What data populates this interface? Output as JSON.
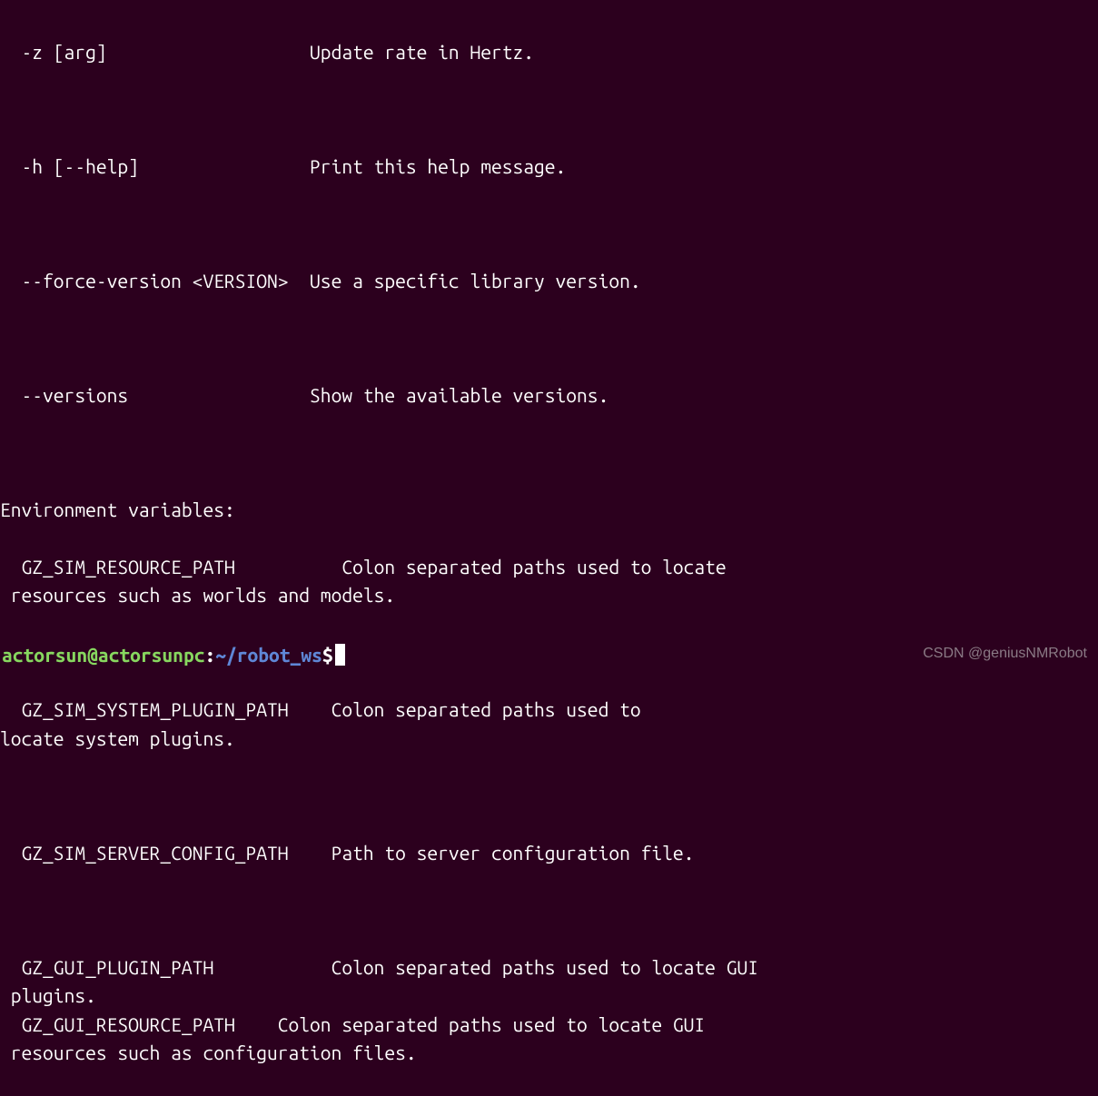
{
  "options": [
    {
      "flag": "  -z [arg]                   ",
      "desc": "Update rate in Hertz."
    },
    {
      "flag": "  -h [--help]                ",
      "desc": "Print this help message."
    },
    {
      "flag": "  --force-version <VERSION>  ",
      "desc": "Use a specific library version."
    },
    {
      "flag": "  --versions                 ",
      "desc": "Show the available versions."
    }
  ],
  "env_section_header": "Environment variables:",
  "env_vars": [
    {
      "text": "  GZ_SIM_RESOURCE_PATH          Colon separated paths used to locate\n resources such as worlds and models."
    },
    {
      "text": "  GZ_SIM_SYSTEM_PLUGIN_PATH    Colon separated paths used to\nlocate system plugins."
    },
    {
      "text": "  GZ_SIM_SERVER_CONFIG_PATH    Path to server configuration file."
    },
    {
      "text": "  GZ_GUI_PLUGIN_PATH           Colon separated paths used to locate GUI\n plugins.\n  GZ_GUI_RESOURCE_PATH    Colon separated paths used to locate GUI\n resources such as configuration files."
    }
  ],
  "prompt": {
    "user": "actorsun",
    "host": "actorsunpc",
    "path": "~/robot_ws",
    "symbol": "$"
  },
  "watermark": "CSDN @geniusNMRobot"
}
